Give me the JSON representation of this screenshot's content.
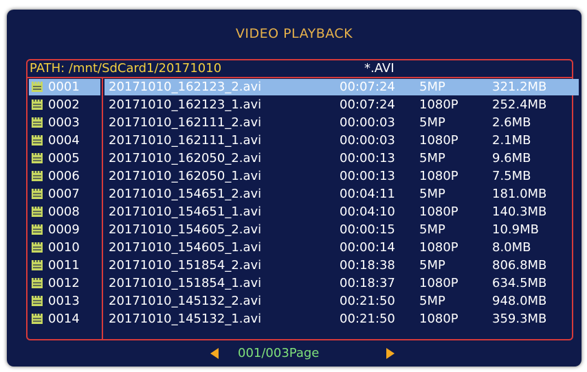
{
  "title": "VIDEO PLAYBACK",
  "path": {
    "label": "PATH: /mnt/SdCard1/20171010",
    "filter": "*.AVI"
  },
  "colors": {
    "background": "#0f1a4a",
    "border": "#d63a3a",
    "title": "#e8b24a",
    "selection": "#8fb8e8",
    "icon": "#c8d860",
    "page": "#7fe07a",
    "arrow": "#f4a820"
  },
  "selected_index": 0,
  "files": [
    {
      "num": "0001",
      "name": "20171010_162123_2.avi",
      "duration": "00:07:24",
      "res": "5MP",
      "size": "321.2MB"
    },
    {
      "num": "0002",
      "name": "20171010_162123_1.avi",
      "duration": "00:07:24",
      "res": "1080P",
      "size": "252.4MB"
    },
    {
      "num": "0003",
      "name": "20171010_162111_2.avi",
      "duration": "00:00:03",
      "res": "5MP",
      "size": "2.6MB"
    },
    {
      "num": "0004",
      "name": "20171010_162111_1.avi",
      "duration": "00:00:03",
      "res": "1080P",
      "size": "2.1MB"
    },
    {
      "num": "0005",
      "name": "20171010_162050_2.avi",
      "duration": "00:00:13",
      "res": "5MP",
      "size": "9.6MB"
    },
    {
      "num": "0006",
      "name": "20171010_162050_1.avi",
      "duration": "00:00:13",
      "res": "1080P",
      "size": "7.5MB"
    },
    {
      "num": "0007",
      "name": "20171010_154651_2.avi",
      "duration": "00:04:11",
      "res": "5MP",
      "size": "181.0MB"
    },
    {
      "num": "0008",
      "name": "20171010_154651_1.avi",
      "duration": "00:04:10",
      "res": "1080P",
      "size": "140.3MB"
    },
    {
      "num": "0009",
      "name": "20171010_154605_2.avi",
      "duration": "00:00:15",
      "res": "5MP",
      "size": "10.9MB"
    },
    {
      "num": "0010",
      "name": "20171010_154605_1.avi",
      "duration": "00:00:14",
      "res": "1080P",
      "size": "8.0MB"
    },
    {
      "num": "0011",
      "name": "20171010_151854_2.avi",
      "duration": "00:18:38",
      "res": "5MP",
      "size": "806.8MB"
    },
    {
      "num": "0012",
      "name": "20171010_151854_1.avi",
      "duration": "00:18:37",
      "res": "1080P",
      "size": "634.5MB"
    },
    {
      "num": "0013",
      "name": "20171010_145132_2.avi",
      "duration": "00:21:50",
      "res": "5MP",
      "size": "948.0MB"
    },
    {
      "num": "0014",
      "name": "20171010_145132_1.avi",
      "duration": "00:21:50",
      "res": "1080P",
      "size": "359.3MB"
    }
  ],
  "pagination": {
    "label": "001/003Page",
    "prev_icon": "triangle-left-icon",
    "next_icon": "triangle-right-icon"
  }
}
